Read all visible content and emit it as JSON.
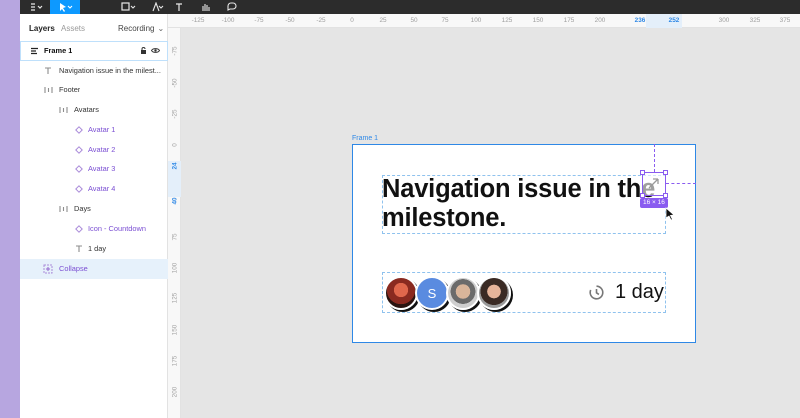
{
  "panel": {
    "tabs": {
      "layers": "Layers",
      "assets": "Assets",
      "recording": "Recording"
    },
    "layers": [
      {
        "label": "Frame 1",
        "icon": "frame-icon",
        "kind": "frame"
      },
      {
        "label": "Navigation issue in the milest...",
        "icon": "text-icon",
        "kind": "text"
      },
      {
        "label": "Footer",
        "icon": "autolayout-icon",
        "kind": "group"
      },
      {
        "label": "Avatars",
        "icon": "autolayout-icon",
        "kind": "group"
      },
      {
        "label": "Avatar 1",
        "icon": "component-instance-icon",
        "kind": "comp"
      },
      {
        "label": "Avatar 2",
        "icon": "component-instance-icon",
        "kind": "comp"
      },
      {
        "label": "Avatar 3",
        "icon": "component-instance-icon",
        "kind": "comp"
      },
      {
        "label": "Avatar 4",
        "icon": "component-instance-icon",
        "kind": "comp"
      },
      {
        "label": "Days",
        "icon": "autolayout-icon",
        "kind": "group"
      },
      {
        "label": "Icon - Countdown",
        "icon": "component-instance-icon",
        "kind": "comp"
      },
      {
        "label": "1 day",
        "icon": "text-icon",
        "kind": "text"
      },
      {
        "label": "Collapse",
        "icon": "component-icon",
        "kind": "selected"
      }
    ]
  },
  "rulers": {
    "horizontal": [
      "-125",
      "-100",
      "-75",
      "-50",
      "-25",
      "0",
      "25",
      "50",
      "75",
      "100",
      "125",
      "150",
      "175",
      "200",
      "236",
      "252",
      "300",
      "325",
      "350",
      "375"
    ],
    "horizontal_highlight": [
      "236",
      "252"
    ],
    "vertical": [
      "-75",
      "-50",
      "-25",
      "0",
      "24",
      "40",
      "75",
      "100",
      "125",
      "150",
      "175",
      "200"
    ],
    "vertical_highlight": [
      "24",
      "40"
    ]
  },
  "canvas": {
    "frame_label": "Frame 1",
    "title": "Navigation issue in the milestone.",
    "avatar2_initial": "S",
    "days": "1 day",
    "selection_size": "16 × 16"
  },
  "colors": {
    "accent": "#0d99ff",
    "selection": "#8a5cf0",
    "frame_outline": "#2e88e6",
    "component_text": "#7b4fd3"
  }
}
